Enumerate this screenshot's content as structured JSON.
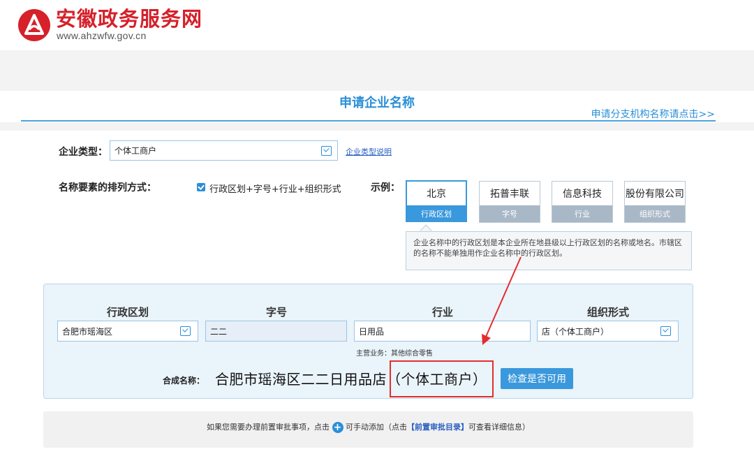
{
  "header": {
    "title": "安徽政务服务网",
    "url": "www.ahzwfw.gov.cn",
    "brand_color": "#d6202a"
  },
  "page": {
    "title": "申请企业名称",
    "branch_link": "申请分支机构名称请点击>>"
  },
  "form": {
    "enterprise_type_label": "企业类型：",
    "enterprise_type_value": "个体工商户",
    "enterprise_type_help": "企业类型说明",
    "arrangement_label": "名称要素的排列方式：",
    "arrangement_option": "行政区划+字号+行业+组织形式",
    "example_label": "示例：",
    "examples": [
      {
        "top": "北京",
        "bottom": "行政区划"
      },
      {
        "top": "拓普丰联",
        "bottom": "字号"
      },
      {
        "top": "信息科技",
        "bottom": "行业"
      },
      {
        "top": "股份有限公司",
        "bottom": "组织形式"
      }
    ],
    "tip": "企业名称中的行政区划是本企业所在地县级以上行政区划的名称或地名。市辖区的名称不能单独用作企业名称中的行政区划。"
  },
  "compose": {
    "headers": [
      "行政区划",
      "字号",
      "行业",
      "组织形式"
    ],
    "region_value": "合肥市瑶海区",
    "brand_value": "二二",
    "industry_value": "日用品",
    "org_value": "店（个体工商户）",
    "main_business": "主营业务：其他综合零售",
    "combined_label": "合成名称：",
    "combined_name": "合肥市瑶海区二二日用品店（个体工商户）",
    "check_button": "检查是否可用"
  },
  "footer": {
    "text_before": "如果您需要办理前置审批事项，点击",
    "text_middle": "可手动添加（点击",
    "link": "【前置审批目录】",
    "text_after": "可查看详细信息）"
  },
  "colors": {
    "accent": "#2a8fd8",
    "highlight": "#e52d2d",
    "panel_bg": "#eaf4fb"
  }
}
